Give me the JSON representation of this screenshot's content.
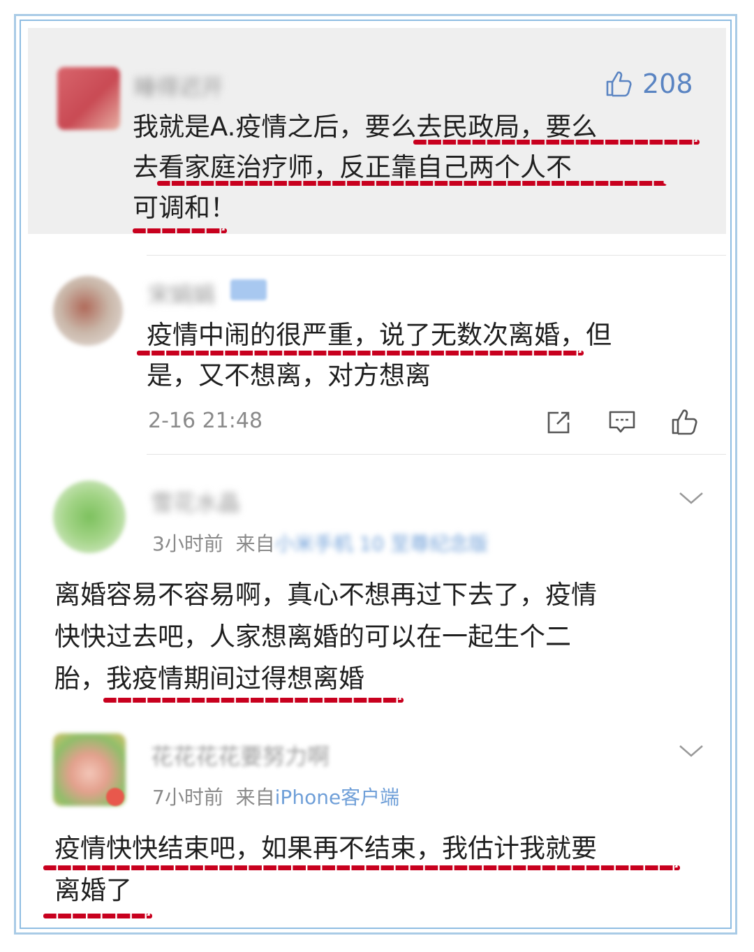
{
  "top_comment": {
    "username": "睡得迟开",
    "like_count": "208",
    "text_lines": [
      "我就是A.疫情之后，要么去民政局，要么",
      "去看家庭治疗师，反正靠自己两个人不",
      "可调和！"
    ]
  },
  "reply": {
    "username": "宋娟娟",
    "text_lines": [
      "疫情中闹的很严重，说了无数次离婚，但",
      "是，又不想离，对方想离"
    ],
    "timestamp": "2-16 21:48"
  },
  "comment2": {
    "username": "雪花水晶",
    "time": "3小时前",
    "from_label": "来自",
    "source": "小米手机 10 至尊纪念版",
    "text_lines": [
      "离婚容易不容易啊，真心不想再过下去了，疫情",
      "快快过去吧，人家想离婚的可以在一起生个二",
      "胎，我疫情期间过得想离婚"
    ]
  },
  "comment3": {
    "username": "花花花花要努力啊",
    "time": "7小时前",
    "from_label": "来自",
    "source": "iPhone客户端",
    "text_lines": [
      "疫情快快结束吧，如果再不结束，我估计我就要",
      "离婚了"
    ]
  },
  "colors": {
    "underline": "#c8001e",
    "frame": "#8fbde2",
    "highlight_bg": "#efefef",
    "icon": "#5a84c2"
  }
}
